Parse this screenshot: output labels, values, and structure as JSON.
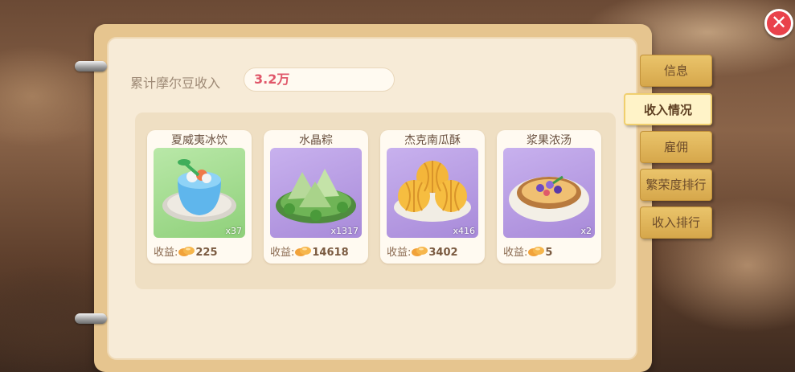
{
  "header": {
    "label": "累计摩尔豆收入",
    "value": "3.2万"
  },
  "items": [
    {
      "name": "夏威夷冰饮",
      "qty": "x37",
      "earn_label": "收益:",
      "earn_value": "225"
    },
    {
      "name": "水晶粽",
      "qty": "x1317",
      "earn_label": "收益:",
      "earn_value": "14618"
    },
    {
      "name": "杰克南瓜酥",
      "qty": "x416",
      "earn_label": "收益:",
      "earn_value": "3402"
    },
    {
      "name": "浆果浓汤",
      "qty": "x2",
      "earn_label": "收益:",
      "earn_value": "5"
    }
  ],
  "tabs": [
    "信息",
    "收入情况",
    "雇佣",
    "繁荣度排行",
    "收入排行"
  ],
  "active_tab": "收入情况",
  "colors": {
    "accent": "#e0576a",
    "tab_gold": "#d6a74b",
    "close_red": "#e9424b"
  }
}
